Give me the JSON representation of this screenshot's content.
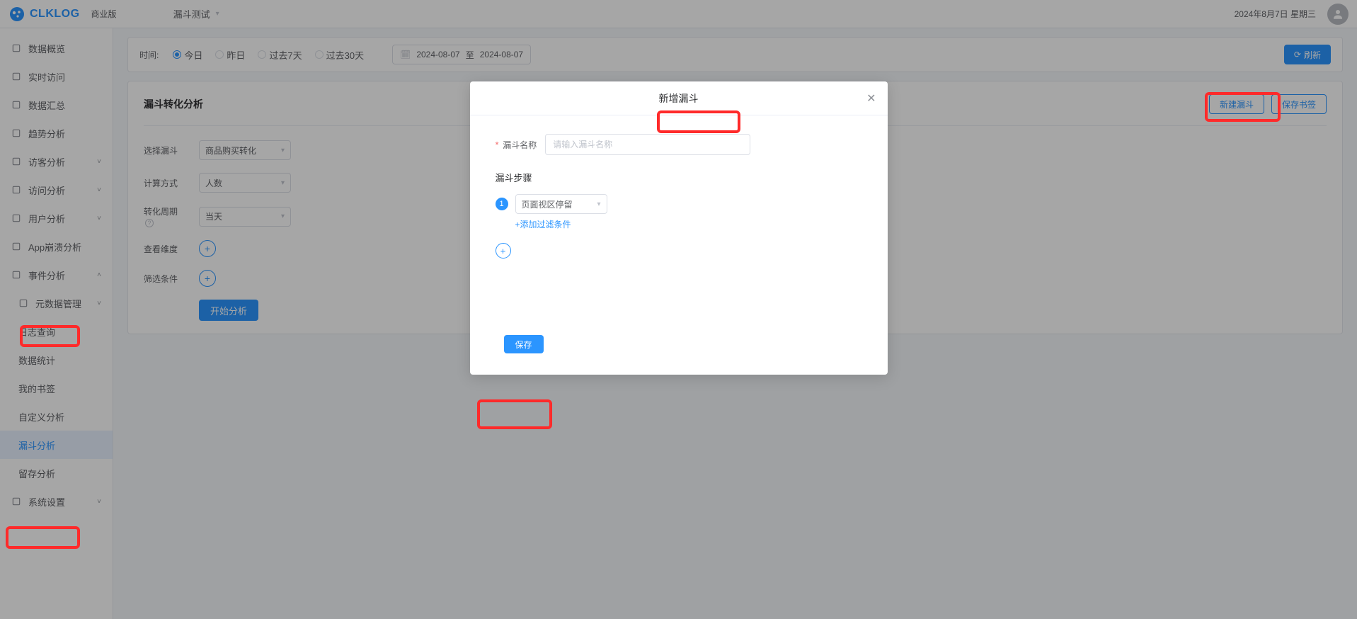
{
  "header": {
    "logo_text": "CLKLOG",
    "logo_badge": "商业版",
    "project_select": "漏斗测试",
    "date_text": "2024年8月7日 星期三"
  },
  "sidebar": {
    "items": [
      {
        "label": "数据概览",
        "icon": "dashboard"
      },
      {
        "label": "实时访问",
        "icon": "realtime"
      },
      {
        "label": "数据汇总",
        "icon": "summary"
      },
      {
        "label": "趋势分析",
        "icon": "trend"
      },
      {
        "label": "访客分析",
        "icon": "visitor",
        "expandable": true
      },
      {
        "label": "访问分析",
        "icon": "visit",
        "expandable": true
      },
      {
        "label": "用户分析",
        "icon": "user",
        "expandable": true
      },
      {
        "label": "App崩溃分析",
        "icon": "crash"
      },
      {
        "label": "事件分析",
        "icon": "event",
        "expandable": true,
        "expanded": true
      },
      {
        "label": "元数据管理",
        "icon": "meta",
        "expandable": true,
        "child": true
      },
      {
        "label": "日志查询",
        "child": true
      },
      {
        "label": "数据统计",
        "child": true
      },
      {
        "label": "我的书签",
        "child": true
      },
      {
        "label": "自定义分析",
        "child": true
      },
      {
        "label": "漏斗分析",
        "child": true,
        "active": true
      },
      {
        "label": "留存分析",
        "child": true
      },
      {
        "label": "系统设置",
        "icon": "settings",
        "expandable": true
      }
    ]
  },
  "filter": {
    "time_label": "时间:",
    "radios": [
      "今日",
      "昨日",
      "过去7天",
      "过去30天"
    ],
    "radio_selected": 0,
    "date_start": "2024-08-07",
    "date_sep": "至",
    "date_end": "2024-08-07",
    "refresh": "刷新"
  },
  "panel": {
    "title": "漏斗转化分析",
    "new_btn": "新建漏斗",
    "save_btn": "保存书签",
    "form": {
      "select_funnel_label": "选择漏斗",
      "select_funnel_value": "商品购买转化",
      "calc_label": "计算方式",
      "calc_value": "人数",
      "period_label": "转化周期",
      "period_value": "当天",
      "dimension_label": "查看维度",
      "filter_label": "筛选条件",
      "start_btn": "开始分析"
    }
  },
  "modal": {
    "title": "新增漏斗",
    "name_label": "漏斗名称",
    "name_placeholder": "请输入漏斗名称",
    "steps_label": "漏斗步骤",
    "step1_badge": "1",
    "step1_value": "页面视区停留",
    "add_filter": "+添加过滤条件",
    "save_btn": "保存"
  }
}
